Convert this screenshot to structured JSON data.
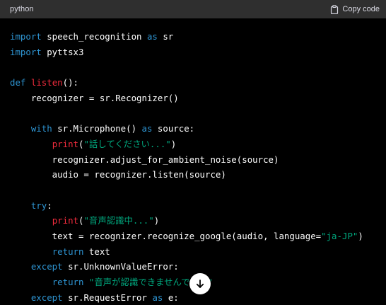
{
  "header": {
    "language": "python",
    "copy_label": "Copy code"
  },
  "icons": {
    "copy": "clipboard-icon",
    "scroll": "arrow-down-icon"
  },
  "colors": {
    "background": "#000000",
    "header_bg": "#2f2f2f",
    "keyword": "#2e95d3",
    "function": "#f22c3d",
    "string": "#00a67d",
    "text": "#ffffff"
  },
  "code": {
    "lines": [
      [
        {
          "t": "import",
          "c": "kw"
        },
        {
          "t": " speech_recognition ",
          "c": "plain"
        },
        {
          "t": "as",
          "c": "kw"
        },
        {
          "t": " sr",
          "c": "plain"
        }
      ],
      [
        {
          "t": "import",
          "c": "kw"
        },
        {
          "t": " pyttsx3",
          "c": "plain"
        }
      ],
      [],
      [
        {
          "t": "def",
          "c": "kw"
        },
        {
          "t": " ",
          "c": "plain"
        },
        {
          "t": "listen",
          "c": "fn"
        },
        {
          "t": "():",
          "c": "plain"
        }
      ],
      [
        {
          "t": "    recognizer = sr.Recognizer()",
          "c": "plain"
        }
      ],
      [],
      [
        {
          "t": "    ",
          "c": "plain"
        },
        {
          "t": "with",
          "c": "kw"
        },
        {
          "t": " sr.Microphone() ",
          "c": "plain"
        },
        {
          "t": "as",
          "c": "kw"
        },
        {
          "t": " source:",
          "c": "plain"
        }
      ],
      [
        {
          "t": "        ",
          "c": "plain"
        },
        {
          "t": "print",
          "c": "fn"
        },
        {
          "t": "(",
          "c": "plain"
        },
        {
          "t": "\"話してください...\"",
          "c": "str"
        },
        {
          "t": ")",
          "c": "plain"
        }
      ],
      [
        {
          "t": "        recognizer.adjust_for_ambient_noise(source)",
          "c": "plain"
        }
      ],
      [
        {
          "t": "        audio = recognizer.listen(source)",
          "c": "plain"
        }
      ],
      [],
      [
        {
          "t": "    ",
          "c": "plain"
        },
        {
          "t": "try",
          "c": "kw"
        },
        {
          "t": ":",
          "c": "plain"
        }
      ],
      [
        {
          "t": "        ",
          "c": "plain"
        },
        {
          "t": "print",
          "c": "fn"
        },
        {
          "t": "(",
          "c": "plain"
        },
        {
          "t": "\"音声認識中...\"",
          "c": "str"
        },
        {
          "t": ")",
          "c": "plain"
        }
      ],
      [
        {
          "t": "        text = recognizer.recognize_google(audio, language=",
          "c": "plain"
        },
        {
          "t": "\"ja-JP\"",
          "c": "str"
        },
        {
          "t": ")",
          "c": "plain"
        }
      ],
      [
        {
          "t": "        ",
          "c": "plain"
        },
        {
          "t": "return",
          "c": "kw"
        },
        {
          "t": " text",
          "c": "plain"
        }
      ],
      [
        {
          "t": "    ",
          "c": "plain"
        },
        {
          "t": "except",
          "c": "kw"
        },
        {
          "t": " sr.UnknownValueError:",
          "c": "plain"
        }
      ],
      [
        {
          "t": "        ",
          "c": "plain"
        },
        {
          "t": "return",
          "c": "kw"
        },
        {
          "t": " ",
          "c": "plain"
        },
        {
          "t": "\"音声が認識できませんでした\"",
          "c": "str"
        }
      ],
      [
        {
          "t": "    ",
          "c": "plain"
        },
        {
          "t": "except",
          "c": "kw"
        },
        {
          "t": " sr.RequestError ",
          "c": "plain"
        },
        {
          "t": "as",
          "c": "kw"
        },
        {
          "t": " e:",
          "c": "plain"
        }
      ]
    ]
  }
}
